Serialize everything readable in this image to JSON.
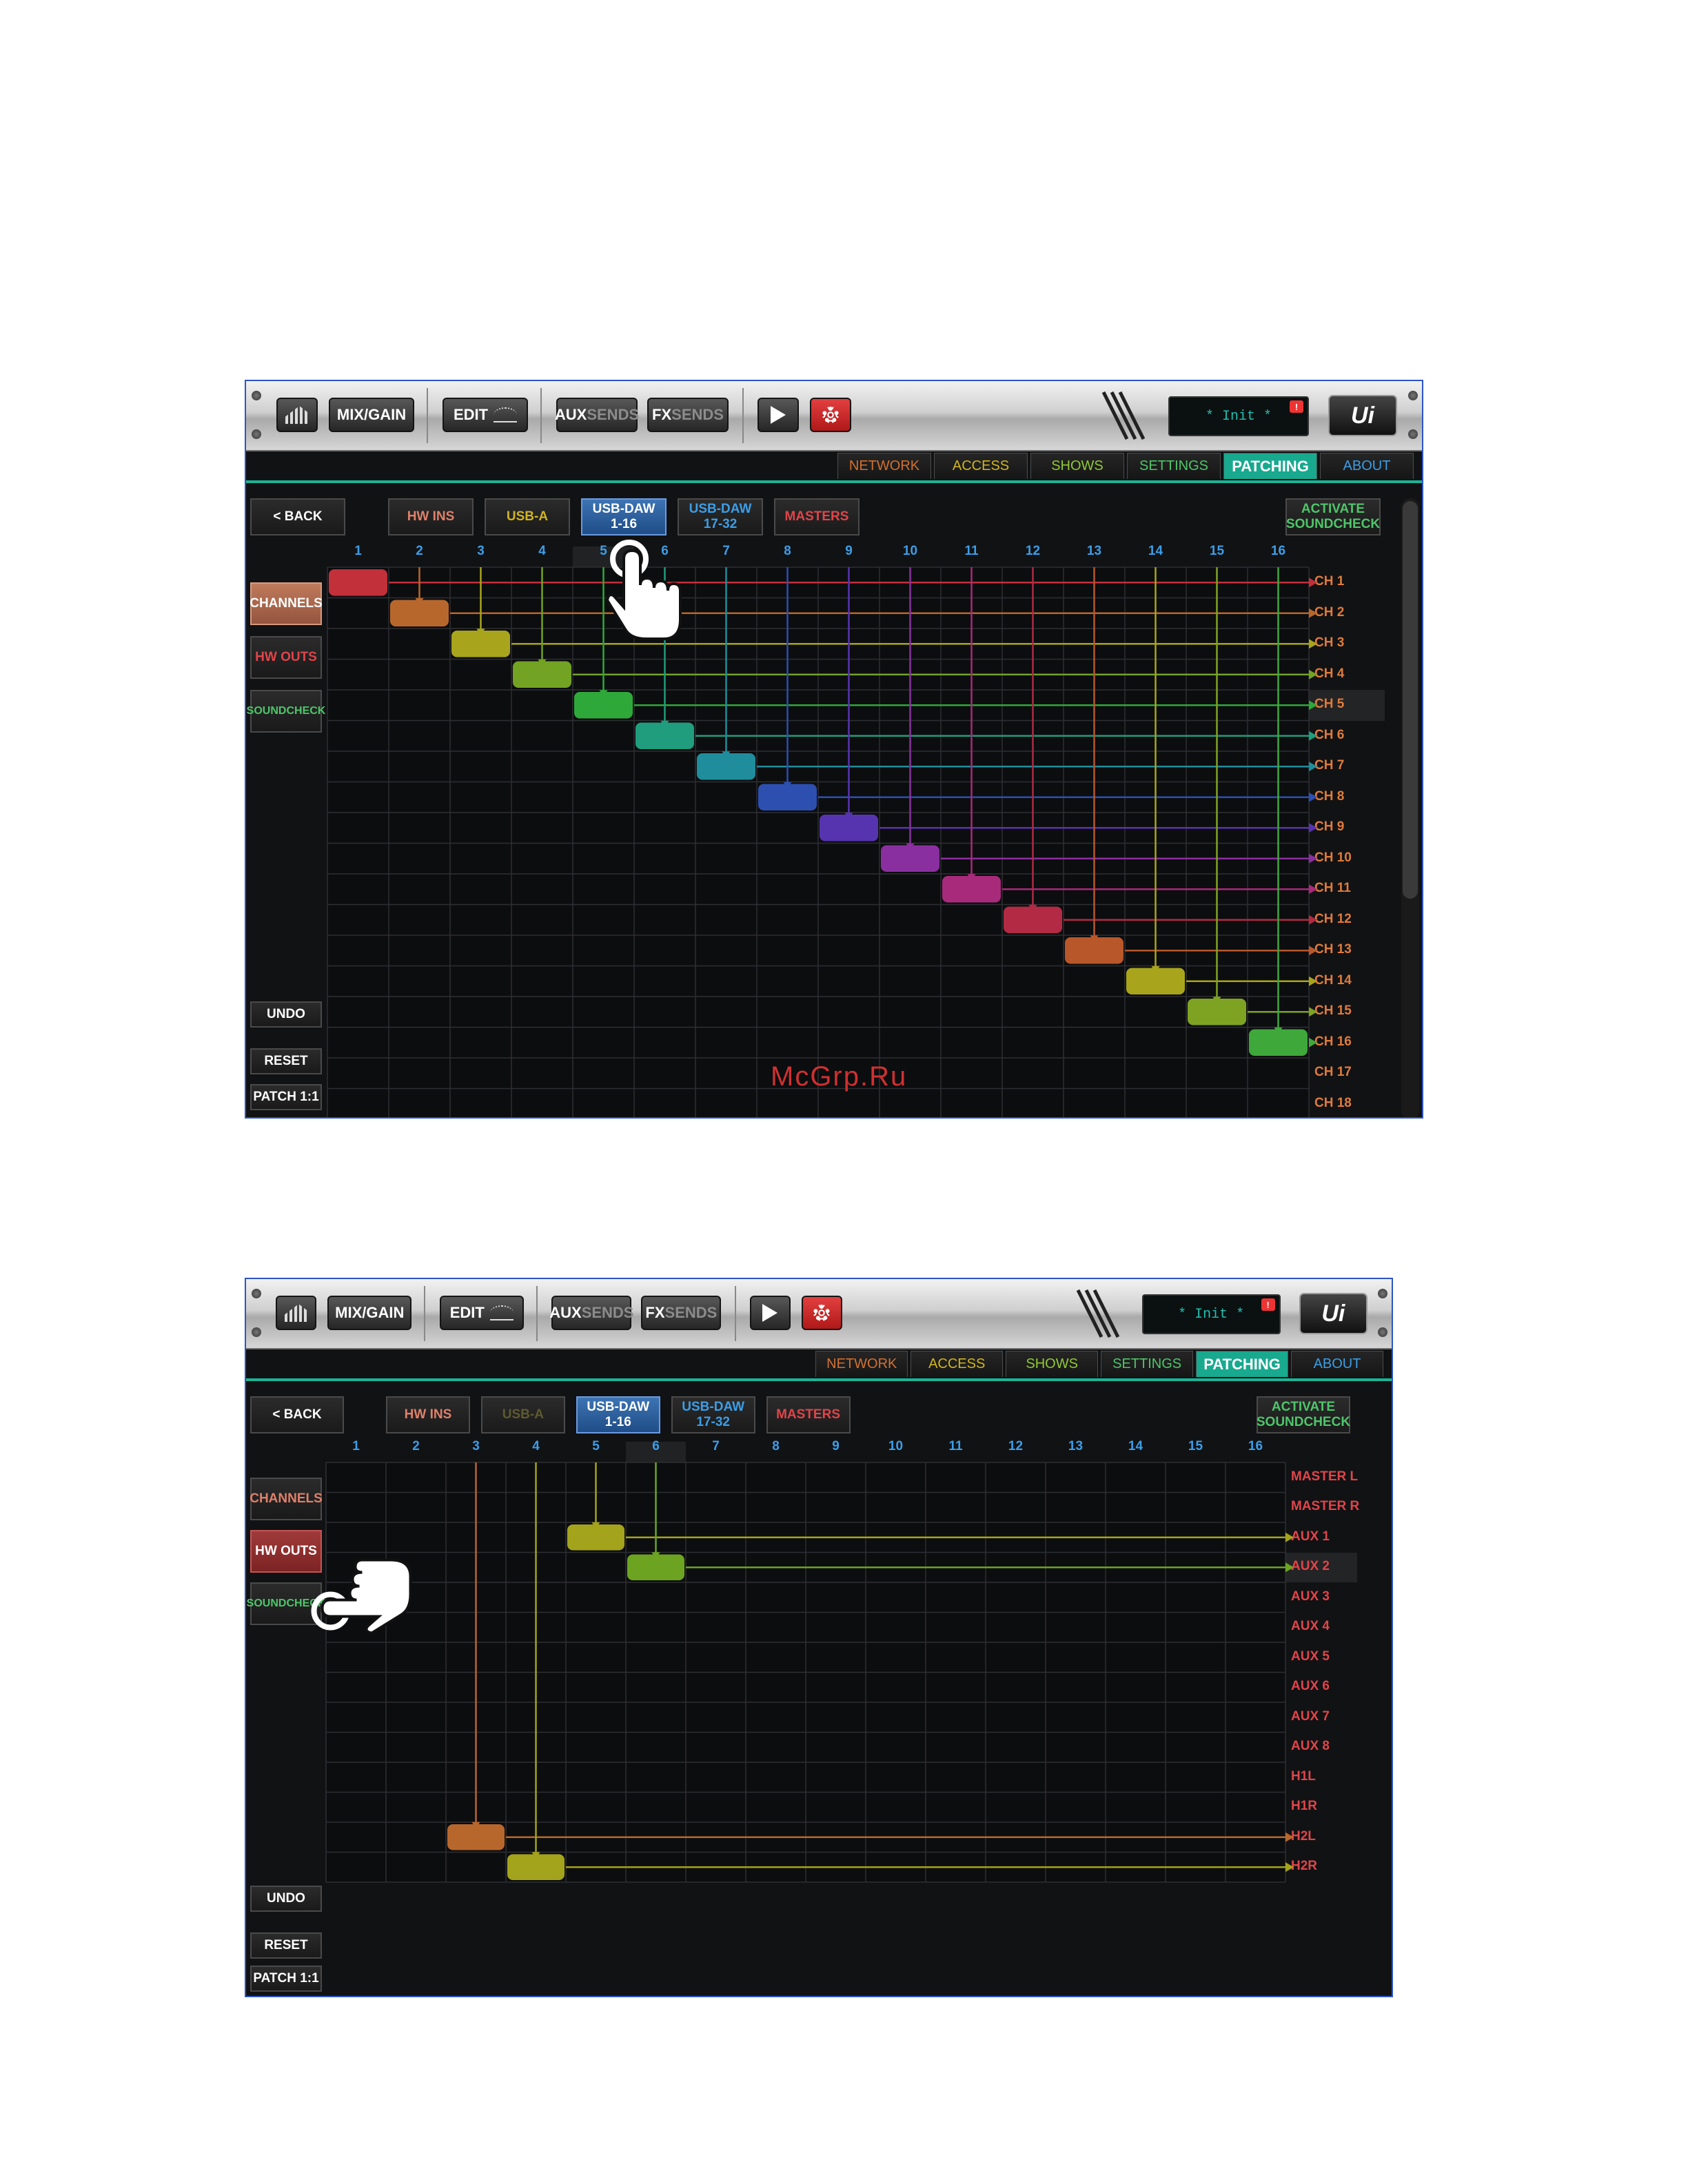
{
  "toolbar": {
    "mix_gain": "MIX/GAIN",
    "edit": "EDIT",
    "aux_a": "AUX",
    "aux_b": "SENDS",
    "fx_a": "FX",
    "fx_b": "SENDS",
    "play_icon": "play-icon",
    "settings_icon": "gear-icon",
    "lcd_text": "* Init *",
    "alert": "!",
    "logo": "Ui"
  },
  "nav_tabs": [
    {
      "label": "NETWORK",
      "color": "#d3702f"
    },
    {
      "label": "ACCESS",
      "color": "#d1b421"
    },
    {
      "label": "SHOWS",
      "color": "#8fc934"
    },
    {
      "label": "SETTINGS",
      "color": "#4ec66a"
    },
    {
      "label": "PATCHING",
      "color": "#ffffff"
    },
    {
      "label": "ABOUT",
      "color": "#3b9ee6"
    }
  ],
  "common": {
    "back": "< BACK",
    "hw_ins": "HW INS",
    "usb_a": "USB-A",
    "usb_daw_1": "USB-DAW",
    "usb_daw_1_sub": "1-16",
    "usb_daw_2": "USB-DAW",
    "usb_daw_2_sub": "17-32",
    "masters": "MASTERS",
    "activate_1": "ACTIVATE",
    "activate_2": "SOUNDCHECK",
    "channels": "CHANNELS",
    "hw_outs": "HW OUTS",
    "soundcheck": "SOUNDCHECK",
    "undo": "UNDO",
    "reset": "RESET",
    "patch11": "PATCH 1:1"
  },
  "columns": [
    "1",
    "2",
    "3",
    "4",
    "5",
    "6",
    "7",
    "8",
    "9",
    "10",
    "11",
    "12",
    "13",
    "14",
    "15",
    "16"
  ],
  "screen1": {
    "rows": [
      "CH 1",
      "CH 2",
      "CH 3",
      "CH 4",
      "CH 5",
      "CH 6",
      "CH 7",
      "CH 8",
      "CH 9",
      "CH 10",
      "CH 11",
      "CH 12",
      "CH 13",
      "CH 14",
      "CH 15",
      "CH 16",
      "CH 17",
      "CH 18"
    ],
    "row_color": "#e07b3a",
    "patches": [
      [
        0,
        0
      ],
      [
        1,
        1
      ],
      [
        2,
        2
      ],
      [
        3,
        3
      ],
      [
        4,
        4
      ],
      [
        5,
        5
      ],
      [
        6,
        6
      ],
      [
        7,
        7
      ],
      [
        8,
        8
      ],
      [
        9,
        9
      ],
      [
        10,
        10
      ],
      [
        11,
        11
      ],
      [
        12,
        12
      ],
      [
        13,
        13
      ],
      [
        14,
        14
      ],
      [
        15,
        15
      ]
    ],
    "patch_colors": [
      "#c2303a",
      "#b8672c",
      "#a8a51c",
      "#72a322",
      "#2fa83a",
      "#1f9d7c",
      "#1f8d9c",
      "#2c4fb0",
      "#5634b0",
      "#8a2fa0",
      "#a82a7a",
      "#b22a44",
      "#b8572a",
      "#a8a51c",
      "#7ea322",
      "#3fa83a"
    ],
    "highlight_col": 4,
    "highlight_row": 4
  },
  "screen2": {
    "rows": [
      "MASTER L",
      "MASTER R",
      "AUX 1",
      "AUX 2",
      "AUX 3",
      "AUX 4",
      "AUX 5",
      "AUX 6",
      "AUX 7",
      "AUX 8",
      "H1L",
      "H1R",
      "H2L",
      "H2R"
    ],
    "row_color": "#e0454a",
    "patches": [
      [
        4,
        2
      ],
      [
        5,
        3
      ],
      [
        2,
        12
      ],
      [
        3,
        13
      ]
    ],
    "patch_colors": [
      "#a3a31c",
      "#6ca422",
      "#b8672c",
      "#a3a31c"
    ],
    "highlight_col": 5,
    "highlight_row": 3
  },
  "watermark": "McGrp.Ru",
  "colors": {
    "accent": "#1bb496",
    "bg": "#111214",
    "grid": "#2e2f33"
  }
}
